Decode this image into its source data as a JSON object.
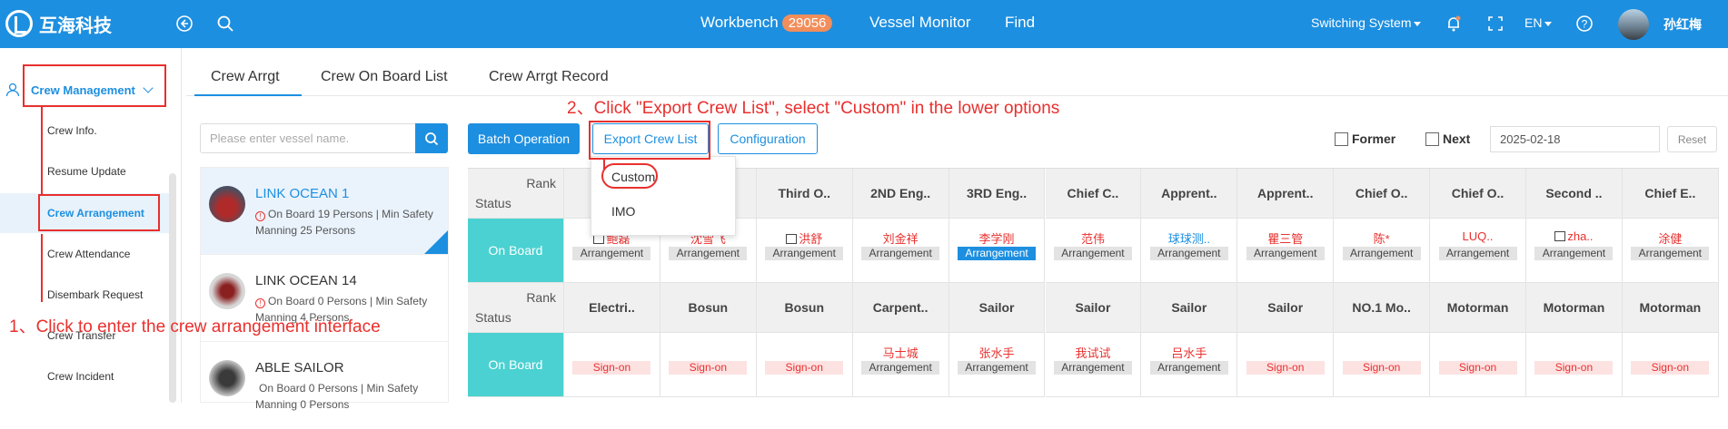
{
  "header": {
    "logo_text": "互海科技",
    "nav": [
      "Workbench",
      "Vessel Monitor",
      "Find"
    ],
    "workbench_badge": "29056",
    "switching_system": "Switching System",
    "language": "EN",
    "user_name": "孙红梅",
    "icons": [
      "back-icon",
      "search-icon",
      "bell-icon",
      "fullscreen-icon",
      "help-icon"
    ]
  },
  "sidebar": {
    "group_label": "Crew Management",
    "items": [
      "Crew Info.",
      "Resume Update",
      "Crew Arrangement",
      "Crew Attendance",
      "Disembark Request",
      "Crew Transfer",
      "Crew Incident"
    ],
    "active_item": "Crew Arrangement"
  },
  "tabs": [
    "Crew Arrgt",
    "Crew On Board List",
    "Crew Arrgt Record"
  ],
  "search": {
    "placeholder": "Please enter vessel name."
  },
  "vessels": [
    {
      "name": "LINK OCEAN 1",
      "info": "On Board 19 Persons | Min Safety Manning 25 Persons",
      "active": true
    },
    {
      "name": "LINK OCEAN 14",
      "info": "On Board 0 Persons | Min Safety Manning 4 Persons",
      "active": false
    },
    {
      "name": "ABLE SAILOR",
      "info": "On Board 0 Persons | Min Safety Manning 0 Persons",
      "active": false
    }
  ],
  "toolbar": {
    "batch_operation": "Batch Operation",
    "export_crew_list": "Export Crew List",
    "configuration": "Configuration",
    "former_label": "Former",
    "next_label": "Next",
    "date_value": "2025-02-18",
    "reset_label": "Reset"
  },
  "export_menu": [
    "Custom",
    "IMO"
  ],
  "grid": {
    "rank_label": "Rank",
    "status_label": "Status",
    "row1_ranks": [
      "",
      "",
      "Third O..",
      "2ND Eng..",
      "3RD Eng..",
      "Chief C..",
      "Apprent..",
      "Apprent..",
      "Chief O..",
      "Chief O..",
      "Second ..",
      "Chief E.."
    ],
    "row1_status": "On Board",
    "row1_crew": [
      {
        "name": "鲍磊",
        "tag": "Arrangement",
        "name_color": "red",
        "tag_style": "grey",
        "doc": true
      },
      {
        "name": "沈雪飞",
        "tag": "Arrangement",
        "name_color": "red",
        "tag_style": "grey",
        "doc": false
      },
      {
        "name": "洪舒",
        "tag": "Arrangement",
        "name_color": "red",
        "tag_style": "grey",
        "doc": true
      },
      {
        "name": "刘金祥",
        "tag": "Arrangement",
        "name_color": "red",
        "tag_style": "grey",
        "doc": false
      },
      {
        "name": "李学刚",
        "tag": "Arrangement",
        "name_color": "red",
        "tag_style": "blue",
        "doc": false
      },
      {
        "name": "范伟",
        "tag": "Arrangement",
        "name_color": "red",
        "tag_style": "grey",
        "doc": false
      },
      {
        "name": "球球测..",
        "tag": "Arrangement",
        "name_color": "blue",
        "tag_style": "grey",
        "doc": false
      },
      {
        "name": "瞿三管",
        "tag": "Arrangement",
        "name_color": "red",
        "tag_style": "grey",
        "doc": false
      },
      {
        "name": "陈*",
        "tag": "Arrangement",
        "name_color": "red",
        "tag_style": "grey",
        "doc": false
      },
      {
        "name": "LUQ..",
        "tag": "Arrangement",
        "name_color": "red",
        "tag_style": "grey",
        "doc": false
      },
      {
        "name": "zha..",
        "tag": "Arrangement",
        "name_color": "red",
        "tag_style": "grey",
        "doc": true
      },
      {
        "name": "涂健",
        "tag": "Arrangement",
        "name_color": "red",
        "tag_style": "grey",
        "doc": false
      }
    ],
    "row2_ranks": [
      "Electri..",
      "Bosun",
      "Bosun",
      "Carpent..",
      "Sailor",
      "Sailor",
      "Sailor",
      "Sailor",
      "NO.1 Mo..",
      "Motorman",
      "Motorman",
      "Motorman"
    ],
    "row2_status": "On Board",
    "row2_crew": [
      {
        "name": "",
        "tag": "Sign-on",
        "name_color": "red",
        "tag_style": "pink"
      },
      {
        "name": "",
        "tag": "Sign-on",
        "name_color": "red",
        "tag_style": "pink"
      },
      {
        "name": "",
        "tag": "Sign-on",
        "name_color": "red",
        "tag_style": "pink"
      },
      {
        "name": "马士城",
        "tag": "Arrangement",
        "name_color": "red",
        "tag_style": "grey"
      },
      {
        "name": "张水手",
        "tag": "Arrangement",
        "name_color": "red",
        "tag_style": "grey"
      },
      {
        "name": "我试试",
        "tag": "Arrangement",
        "name_color": "red",
        "tag_style": "grey"
      },
      {
        "name": "吕水手",
        "tag": "Arrangement",
        "name_color": "red",
        "tag_style": "grey"
      },
      {
        "name": "",
        "tag": "Sign-on",
        "name_color": "red",
        "tag_style": "pink"
      },
      {
        "name": "",
        "tag": "Sign-on",
        "name_color": "red",
        "tag_style": "pink"
      },
      {
        "name": "",
        "tag": "Sign-on",
        "name_color": "red",
        "tag_style": "pink"
      },
      {
        "name": "",
        "tag": "Sign-on",
        "name_color": "red",
        "tag_style": "pink"
      },
      {
        "name": "",
        "tag": "Sign-on",
        "name_color": "red",
        "tag_style": "pink"
      }
    ]
  },
  "annotations": {
    "step1": "1、Click to enter the crew arrangement interface",
    "step2": "2、Click \"Export Crew List\", select \"Custom\" in the lower options"
  },
  "colors": {
    "brand": "#1d8fe0",
    "annotation": "#e8302e",
    "status": "#4bd1d1"
  }
}
